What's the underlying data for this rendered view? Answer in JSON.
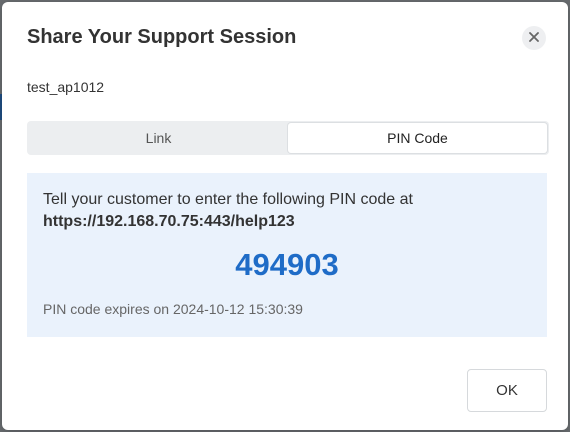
{
  "dialog": {
    "title": "Share Your Support Session",
    "session_name": "test_ap1012",
    "tabs": [
      {
        "label": "Link",
        "active": false
      },
      {
        "label": "PIN Code",
        "active": true
      }
    ],
    "pin": {
      "instruction": "Tell your customer to enter the following PIN code at",
      "url": "https://192.168.70.75:443/help123",
      "code": "494903",
      "expiry": "PIN code expires on 2024-10-12 15:30:39"
    },
    "ok_label": "OK",
    "close_icon": "close-icon"
  },
  "colors": {
    "pin_code": "#1f6cc7",
    "panel_bg": "#eaf2fc"
  }
}
